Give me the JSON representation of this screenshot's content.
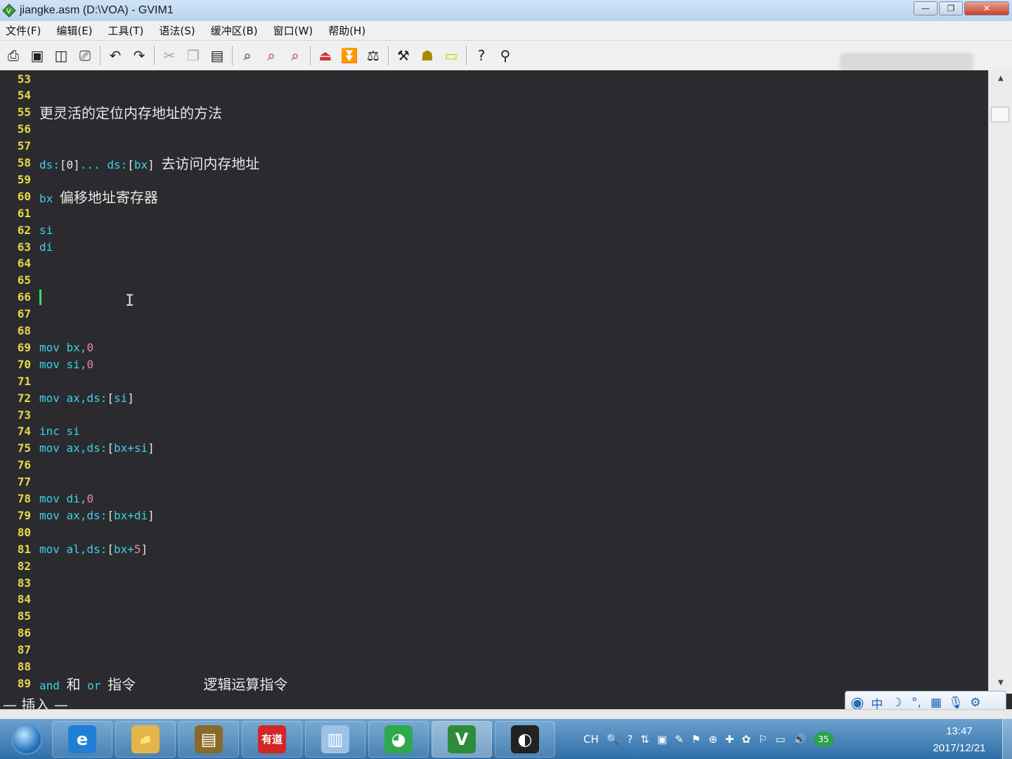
{
  "window": {
    "title": "jiangke.asm (D:\\VOA) - GVIM1",
    "minimize": "—",
    "maximize": "❐",
    "close": "✕"
  },
  "menu": {
    "items": [
      "文件(F)",
      "编辑(E)",
      "工具(T)",
      "语法(S)",
      "缓冲区(B)",
      "窗口(W)",
      "帮助(H)"
    ]
  },
  "toolbar": {
    "icons": [
      "open-icon",
      "save-icon",
      "save-all-icon",
      "print-icon",
      "undo-icon",
      "redo-icon",
      "cut-icon",
      "copy-icon",
      "paste-icon",
      "find-icon",
      "find-next-icon",
      "find-prev-icon",
      "load-session-icon",
      "save-session-icon",
      "run-script-icon",
      "make-icon",
      "shell-icon",
      "tag-icon",
      "help-icon",
      "find-help-icon"
    ]
  },
  "editor": {
    "lines": [
      {
        "n": "53",
        "segments": []
      },
      {
        "n": "54",
        "segments": []
      },
      {
        "n": "55",
        "segments": [
          {
            "t": "更灵活的定位内存地址的方法",
            "c": "txt"
          }
        ]
      },
      {
        "n": "56",
        "segments": []
      },
      {
        "n": "57",
        "segments": []
      },
      {
        "n": "58",
        "segments": [
          {
            "t": "ds:",
            "c": "kw"
          },
          {
            "t": "[0]",
            "c": "brk"
          },
          {
            "t": "... ds:",
            "c": "kw"
          },
          {
            "t": "[",
            "c": "brk"
          },
          {
            "t": "bx",
            "c": "kw"
          },
          {
            "t": "]",
            "c": "brk"
          },
          {
            "t": " ",
            "c": "kw"
          },
          {
            "t": "去访问内存地址",
            "c": "txt"
          }
        ]
      },
      {
        "n": "59",
        "segments": []
      },
      {
        "n": "60",
        "segments": [
          {
            "t": "bx ",
            "c": "kw"
          },
          {
            "t": "偏移地址寄存器",
            "c": "txt"
          }
        ]
      },
      {
        "n": "61",
        "segments": []
      },
      {
        "n": "62",
        "segments": [
          {
            "t": "si",
            "c": "kw"
          }
        ]
      },
      {
        "n": "63",
        "segments": [
          {
            "t": "di",
            "c": "kw"
          }
        ]
      },
      {
        "n": "64",
        "segments": []
      },
      {
        "n": "65",
        "segments": []
      },
      {
        "n": "66",
        "segments": [],
        "cursor": true
      },
      {
        "n": "67",
        "segments": []
      },
      {
        "n": "68",
        "segments": []
      },
      {
        "n": "69",
        "segments": [
          {
            "t": "mov bx,",
            "c": "kw"
          },
          {
            "t": "0",
            "c": "num"
          }
        ]
      },
      {
        "n": "70",
        "segments": [
          {
            "t": "mov si,",
            "c": "kw"
          },
          {
            "t": "0",
            "c": "num"
          }
        ]
      },
      {
        "n": "71",
        "segments": []
      },
      {
        "n": "72",
        "segments": [
          {
            "t": "mov ax,ds:",
            "c": "kw"
          },
          {
            "t": "[",
            "c": "brk"
          },
          {
            "t": "si",
            "c": "kw"
          },
          {
            "t": "]",
            "c": "brk"
          }
        ]
      },
      {
        "n": "73",
        "segments": []
      },
      {
        "n": "74",
        "segments": [
          {
            "t": "inc si",
            "c": "kw"
          }
        ]
      },
      {
        "n": "75",
        "segments": [
          {
            "t": "mov ax,ds:",
            "c": "kw"
          },
          {
            "t": "[",
            "c": "brk"
          },
          {
            "t": "bx+si",
            "c": "kw"
          },
          {
            "t": "]",
            "c": "brk"
          }
        ]
      },
      {
        "n": "76",
        "segments": []
      },
      {
        "n": "77",
        "segments": []
      },
      {
        "n": "78",
        "segments": [
          {
            "t": "mov di,",
            "c": "kw"
          },
          {
            "t": "0",
            "c": "num"
          }
        ]
      },
      {
        "n": "79",
        "segments": [
          {
            "t": "mov ax,ds:",
            "c": "kw"
          },
          {
            "t": "[",
            "c": "brk"
          },
          {
            "t": "bx+di",
            "c": "kw"
          },
          {
            "t": "]",
            "c": "brk"
          }
        ]
      },
      {
        "n": "80",
        "segments": []
      },
      {
        "n": "81",
        "segments": [
          {
            "t": "mov al,ds:",
            "c": "kw"
          },
          {
            "t": "[",
            "c": "brk"
          },
          {
            "t": "bx+",
            "c": "kw"
          },
          {
            "t": "5",
            "c": "num"
          },
          {
            "t": "]",
            "c": "brk"
          }
        ]
      },
      {
        "n": "82",
        "segments": []
      },
      {
        "n": "83",
        "segments": []
      },
      {
        "n": "84",
        "segments": []
      },
      {
        "n": "85",
        "segments": []
      },
      {
        "n": "86",
        "segments": []
      },
      {
        "n": "87",
        "segments": []
      },
      {
        "n": "88",
        "segments": []
      },
      {
        "n": "89",
        "segments": [
          {
            "t": "and ",
            "c": "kw"
          },
          {
            "t": "和",
            "c": "txt"
          },
          {
            "t": " or ",
            "c": "kw"
          },
          {
            "t": "指令",
            "c": "txt"
          },
          {
            "t": "          ",
            "c": "kw"
          },
          {
            "t": "逻辑运算指令",
            "c": "txt"
          }
        ]
      }
    ]
  },
  "status": {
    "mode": "— 插入 —"
  },
  "ime": {
    "icons": [
      "ime-logo-icon",
      "chinese-mode-icon",
      "half-width-icon",
      "punctuation-icon",
      "keyboard-icon",
      "microphone-icon",
      "settings-icon"
    ],
    "glyphs": [
      "◉",
      "中",
      "☽",
      "°,",
      "▦",
      "🎙",
      "⚙"
    ]
  },
  "taskbar": {
    "apps": [
      {
        "name": "ie-icon",
        "glyph": "e",
        "color": "#1f7fd6"
      },
      {
        "name": "explorer-icon",
        "glyph": "📁",
        "color": "#e2b64a"
      },
      {
        "name": "book-app-icon",
        "glyph": "▤",
        "color": "#8a6a2c"
      },
      {
        "name": "youdao-icon",
        "glyph": "有道",
        "color": "#d32626"
      },
      {
        "name": "notes-icon",
        "glyph": "▥",
        "color": "#9cc2e6"
      },
      {
        "name": "chrome-icon",
        "glyph": "◕",
        "color": "#2eaa4d"
      },
      {
        "name": "gvim-icon",
        "glyph": "V",
        "color": "#2e8b3a"
      },
      {
        "name": "obs-icon",
        "glyph": "◐",
        "color": "#222222"
      }
    ],
    "tray": [
      "CH",
      "🔍",
      "?",
      "⇅",
      "▣",
      "✎",
      "⚑",
      "⊕",
      "✚",
      "✿",
      "⚐",
      "▭",
      "🔊",
      "35"
    ],
    "clock_time": "13:47",
    "clock_date": "2017/12/21"
  }
}
